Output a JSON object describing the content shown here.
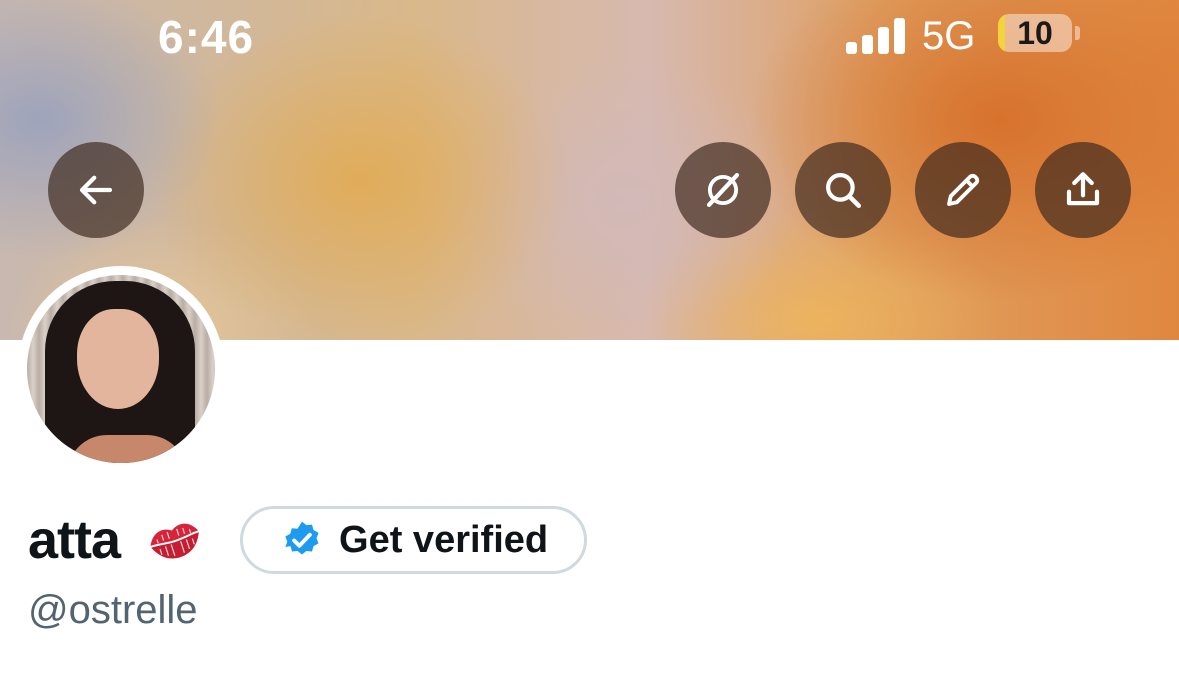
{
  "status_bar": {
    "time": "6:46",
    "network": "5G",
    "battery_level": "10",
    "battery_fraction": 0.1,
    "signal_bars": 4,
    "icons": [
      "signal-icon",
      "battery-icon"
    ]
  },
  "header": {
    "buttons": [
      {
        "name": "back-button",
        "icon": "arrow-left-icon"
      },
      {
        "name": "grok-button",
        "icon": "grok-icon"
      },
      {
        "name": "search-button",
        "icon": "search-icon"
      },
      {
        "name": "edit-button",
        "icon": "pencil-icon"
      },
      {
        "name": "share-button",
        "icon": "share-icon"
      }
    ]
  },
  "profile": {
    "display_name": "atta",
    "name_emoji": "💋",
    "handle": "@ostrelle",
    "verify_button_label": "Get verified",
    "verify_icon": "verified-badge-icon"
  },
  "colors": {
    "text_primary": "#0f1419",
    "text_secondary": "#536471",
    "verified_blue": "#1d9bf0",
    "button_overlay": "#3c281e",
    "border": "#cfd9de"
  }
}
